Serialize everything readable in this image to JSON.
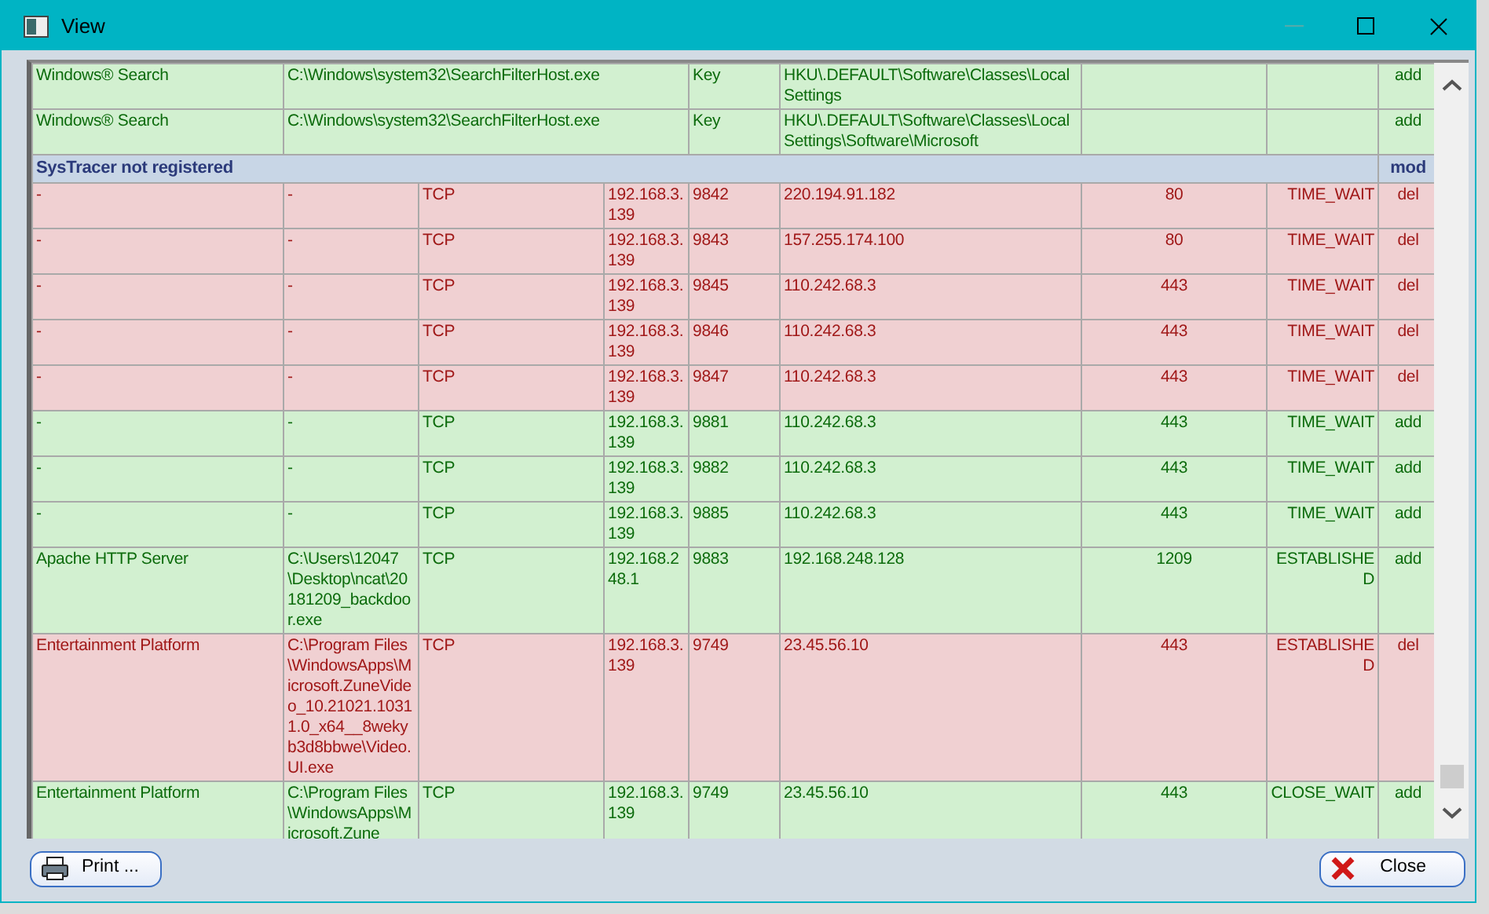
{
  "window": {
    "title": "View"
  },
  "rows": [
    {
      "kind": "registry",
      "deleted": false,
      "cells": [
        "Windows® Search",
        "C:\\Windows\\system32\\SearchFilterHost.exe",
        "Key",
        "HKU\\.DEFAULT\\Software\\Classes\\Local Settings",
        "add"
      ]
    },
    {
      "kind": "registry",
      "deleted": false,
      "cells": [
        "Windows® Search",
        "C:\\Windows\\system32\\SearchFilterHost.exe",
        "Key",
        "HKU\\.DEFAULT\\Software\\Classes\\Local Settings\\Software\\Microsoft",
        "add"
      ]
    },
    {
      "kind": "group",
      "title": "SysTracer not registered",
      "action": "mod"
    },
    {
      "kind": "network",
      "deleted": true,
      "cells": [
        "-",
        "-",
        "TCP",
        "192.168.3.139",
        "9842",
        "220.194.91.182",
        "80",
        "TIME_WAIT",
        "del"
      ]
    },
    {
      "kind": "network",
      "deleted": true,
      "cells": [
        "-",
        "-",
        "TCP",
        "192.168.3.139",
        "9843",
        "157.255.174.100",
        "80",
        "TIME_WAIT",
        "del"
      ]
    },
    {
      "kind": "network",
      "deleted": true,
      "cells": [
        "-",
        "-",
        "TCP",
        "192.168.3.139",
        "9845",
        "110.242.68.3",
        "443",
        "TIME_WAIT",
        "del"
      ]
    },
    {
      "kind": "network",
      "deleted": true,
      "cells": [
        "-",
        "-",
        "TCP",
        "192.168.3.139",
        "9846",
        "110.242.68.3",
        "443",
        "TIME_WAIT",
        "del"
      ]
    },
    {
      "kind": "network",
      "deleted": true,
      "cells": [
        "-",
        "-",
        "TCP",
        "192.168.3.139",
        "9847",
        "110.242.68.3",
        "443",
        "TIME_WAIT",
        "del"
      ]
    },
    {
      "kind": "network",
      "deleted": false,
      "cells": [
        "-",
        "-",
        "TCP",
        "192.168.3.139",
        "9881",
        "110.242.68.3",
        "443",
        "TIME_WAIT",
        "add"
      ]
    },
    {
      "kind": "network",
      "deleted": false,
      "cells": [
        "-",
        "-",
        "TCP",
        "192.168.3.139",
        "9882",
        "110.242.68.3",
        "443",
        "TIME_WAIT",
        "add"
      ]
    },
    {
      "kind": "network",
      "deleted": false,
      "cells": [
        "-",
        "-",
        "TCP",
        "192.168.3.139",
        "9885",
        "110.242.68.3",
        "443",
        "TIME_WAIT",
        "add"
      ]
    },
    {
      "kind": "network",
      "deleted": false,
      "cells": [
        "Apache HTTP Server",
        "C:\\Users\\12047\\Desktop\\ncat\\20181209_backdoor.exe",
        "TCP",
        "192.168.248.1",
        "9883",
        "192.168.248.128",
        "1209",
        "ESTABLISHED",
        "add"
      ]
    },
    {
      "kind": "network",
      "deleted": true,
      "cells": [
        "Entertainment Platform",
        "C:\\Program Files\\WindowsApps\\Microsoft.ZuneVideo_10.21021.10311.0_x64__8wekyb3d8bbwe\\Video.UI.exe",
        "TCP",
        "192.168.3.139",
        "9749",
        "23.45.56.10",
        "443",
        "ESTABLISHED",
        "del"
      ]
    },
    {
      "kind": "network",
      "deleted": false,
      "cells": [
        "Entertainment Platform",
        "C:\\Program Files\\WindowsApps\\Microsoft.Zune",
        "TCP",
        "192.168.3.139",
        "9749",
        "23.45.56.10",
        "443",
        "CLOSE_WAIT",
        "add"
      ]
    }
  ],
  "buttons": [
    {
      "kind": "print",
      "label": "Print ..."
    },
    {
      "kind": "close",
      "label": "Close"
    }
  ]
}
